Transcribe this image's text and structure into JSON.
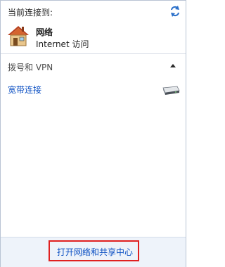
{
  "header": {
    "label": "当前连接到:"
  },
  "network": {
    "name": "网络",
    "status": "Internet 访问"
  },
  "dialup_section": {
    "title": "拨号和 VPN",
    "connections": [
      {
        "label": "宽带连接"
      }
    ]
  },
  "footer": {
    "link_label": "打开网络和共享中心"
  },
  "colors": {
    "link": "#0a4ec2",
    "footer_bg": "#eef3fa",
    "highlight_box": "#e02020"
  },
  "icons": [
    "refresh-icon",
    "network-house-icon",
    "collapse-arrow-icon",
    "broadband-modem-icon"
  ]
}
